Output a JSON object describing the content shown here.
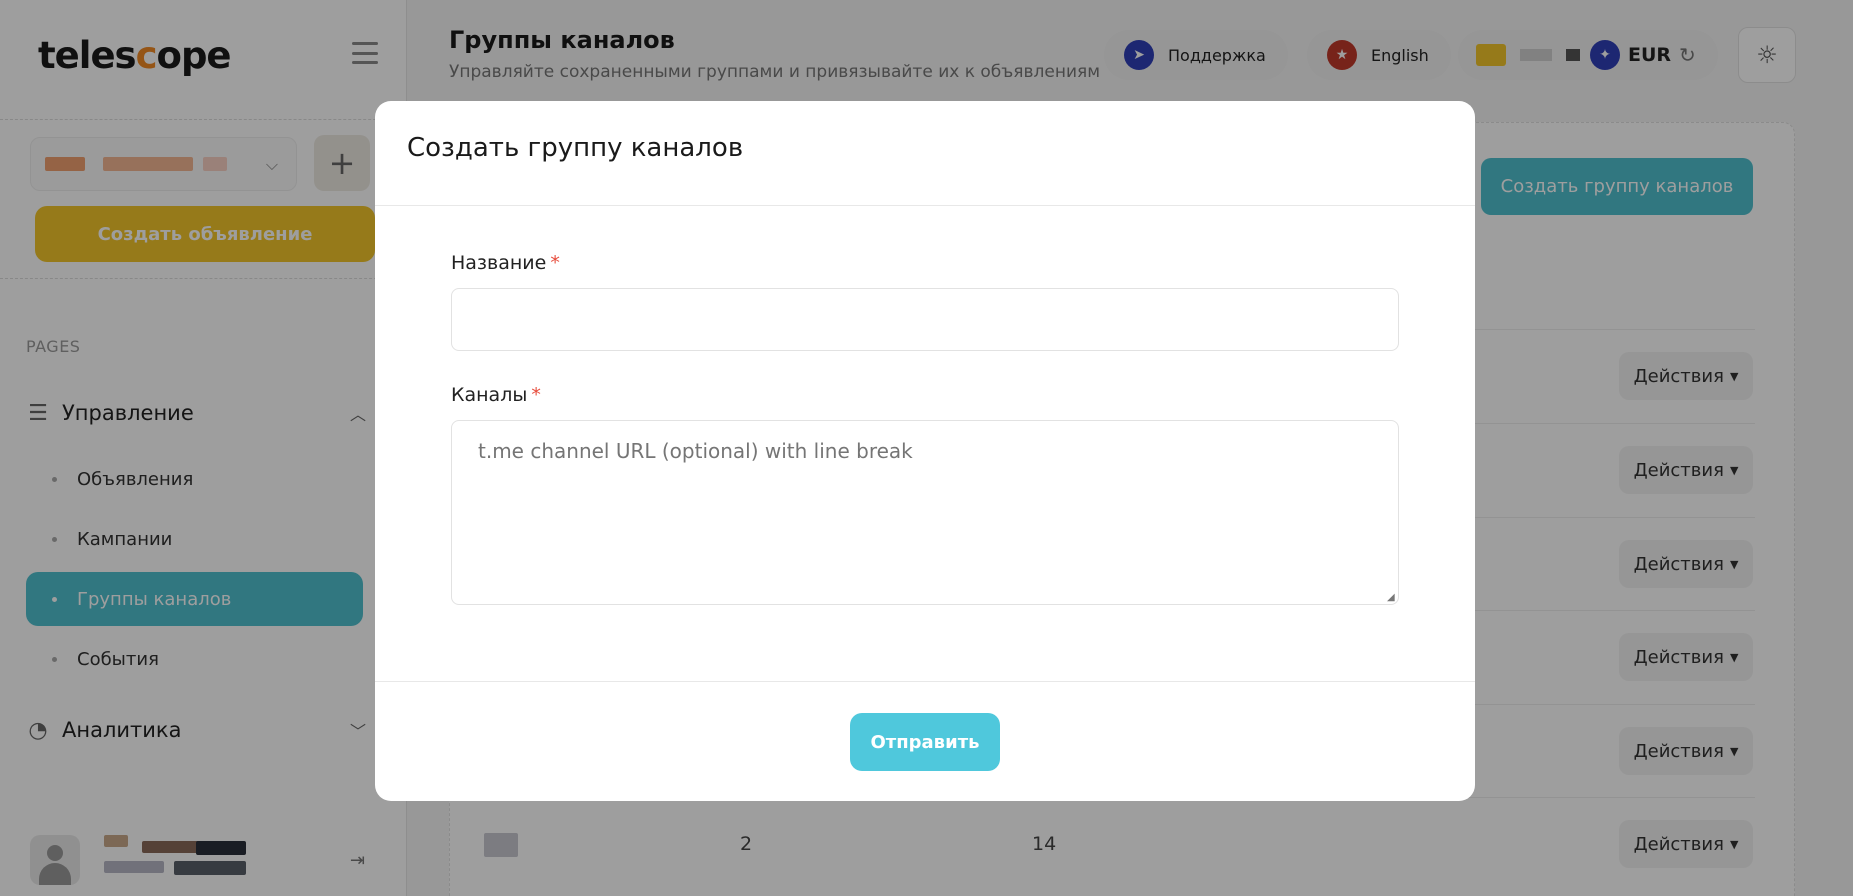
{
  "brand": {
    "logo_pre": "teles",
    "logo_cat": "c",
    "logo_post": "ope"
  },
  "sidebar": {
    "create_ad_label": "Создать объявление",
    "pages_label": "PAGES",
    "groups": [
      {
        "label": "Управление",
        "icon": "list-icon",
        "expanded": true
      },
      {
        "label": "Аналитика",
        "icon": "pie-chart-icon",
        "expanded": false
      }
    ],
    "items": [
      {
        "label": "Объявления",
        "active": false
      },
      {
        "label": "Кампании",
        "active": false
      },
      {
        "label": "Группы каналов",
        "active": true
      },
      {
        "label": "События",
        "active": false
      }
    ]
  },
  "header": {
    "title": "Группы каналов",
    "subtitle": "Управляйте сохраненными группами и привязывайте их к объявлениям",
    "support_label": "Поддержка",
    "language_label": "English",
    "currency_label": "EUR"
  },
  "main": {
    "create_group_label": "Создать группу каналов",
    "actions_label": "Действия",
    "last_row": {
      "col2": "2",
      "col3": "14"
    }
  },
  "modal": {
    "title": "Создать группу каналов",
    "name_label": "Название",
    "channels_label": "Каналы",
    "required_mark": "*",
    "channels_placeholder": "t.me channel URL (optional) with line break",
    "submit_label": "Отправить"
  },
  "colors": {
    "accent": "#4fc0cf",
    "primary_yellow": "#f2c62a",
    "required": "#e74c3c"
  }
}
